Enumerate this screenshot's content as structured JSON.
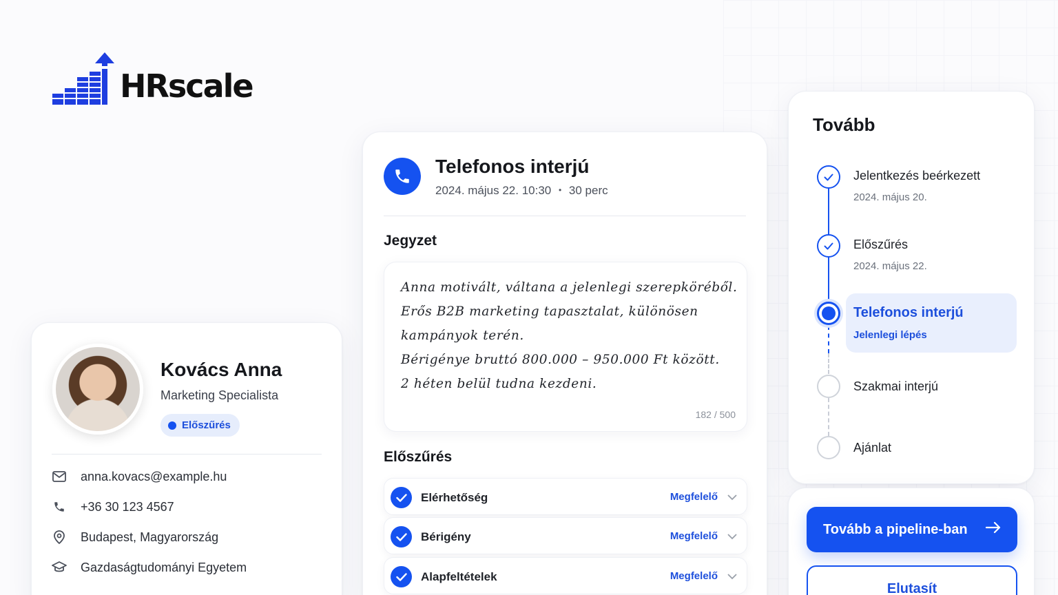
{
  "brand": {
    "name": "HRscale",
    "accent": "#1552f0"
  },
  "profile": {
    "name": "Kovács Anna",
    "role": "Marketing Specialista",
    "stage_badge": "Előszűrés",
    "contacts": [
      {
        "icon": "mail-icon",
        "text": "anna.kovacs@example.hu"
      },
      {
        "icon": "phone-icon",
        "text": "+36 30 123 4567"
      },
      {
        "icon": "location-pin-icon",
        "text": "Budapest, Magyarország"
      },
      {
        "icon": "graduation-cap-icon",
        "text": "Gazdaságtudományi Egyetem"
      }
    ]
  },
  "interview": {
    "title": "Telefonos interjú",
    "date": "2024. május 22. 10:30",
    "separator": "•",
    "duration": "30 perc",
    "note_heading": "Jegyzet",
    "note_lines": [
      "Anna motivált, váltana a jelenlegi szerepköréből.",
      "Erős B2B marketing tapasztalat, különösen",
      "kampányok terén.",
      "Bérigénye bruttó 800.000 – 950.000 Ft között.",
      "2 héten belül tudna kezdeni."
    ],
    "note_counter": "182 / 500",
    "screening_heading": "Előszűrés",
    "checks": [
      {
        "label": "Elérhetőség",
        "status": "Megfelelő"
      },
      {
        "label": "Bérigény",
        "status": "Megfelelő"
      },
      {
        "label": "Alapfeltételek",
        "status": "Megfelelő"
      }
    ]
  },
  "pipeline": {
    "title": "Tovább",
    "steps": [
      {
        "label": "Jelentkezés beérkezett",
        "date": "2024. május 20.",
        "state": "done"
      },
      {
        "label": "Előszűrés",
        "date": "2024. május 22.",
        "state": "done"
      },
      {
        "label": "Telefonos interjú",
        "sub": "Jelenlegi lépés",
        "state": "current"
      },
      {
        "label": "Szakmai interjú",
        "state": "todo"
      },
      {
        "label": "Ajánlat",
        "state": "todo"
      }
    ]
  },
  "actions": {
    "primary": "Tovább a pipeline-ban",
    "primary_icon": "arrow-right-icon",
    "secondary": "Elutasít"
  }
}
